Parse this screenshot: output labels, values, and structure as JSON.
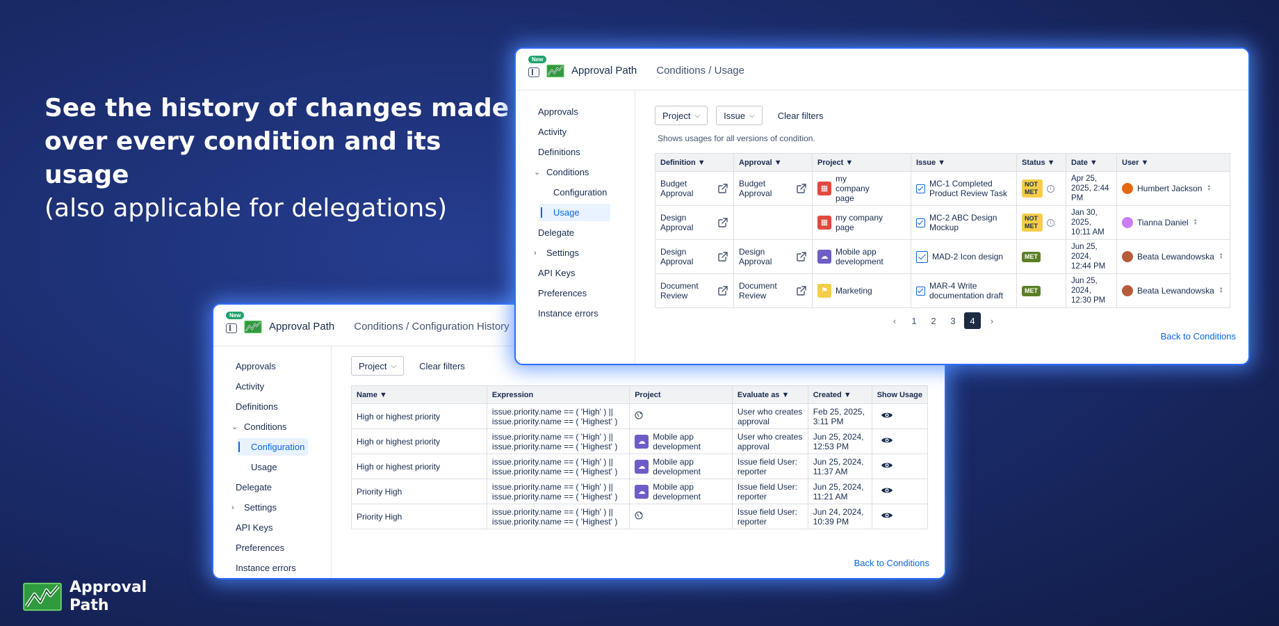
{
  "headline": {
    "bold": "See the history of changes made over every condition and its usage",
    "light": "(also applicable for delegations)"
  },
  "brand": {
    "name_line1": "Approval",
    "name_line2": "Path"
  },
  "colors": {
    "accent": "#0c66e4",
    "glow": "#2d6bff",
    "met": "#5b7f24",
    "not_met": "#f5cd47"
  },
  "usage_window": {
    "badge": "New",
    "app_name": "Approval Path",
    "breadcrumb": "Conditions / Usage",
    "sidebar": [
      "Approvals",
      "Activity",
      "Definitions",
      "Conditions",
      "Configuration",
      "Usage",
      "Delegate",
      "Settings",
      "API Keys",
      "Preferences",
      "Instance errors"
    ],
    "filters": {
      "project": "Project",
      "issue": "Issue",
      "clear": "Clear filters"
    },
    "note": "Shows usages for all versions of condition.",
    "columns": [
      "Definition ▼",
      "Approval ▼",
      "Project ▼",
      "Issue ▼",
      "Status ▼",
      "Date ▼",
      "User ▼"
    ],
    "rows": [
      {
        "definition": "Budget Approval",
        "approval": "Budget Approval",
        "project": "my company page",
        "issue": "MC-1 Completed Product Review Task",
        "status": "NOT MET",
        "date": "Apr 25, 2025, 2:44 PM",
        "user": "Humbert Jackson"
      },
      {
        "definition": "Design Approval",
        "approval": "",
        "project": "my company page",
        "issue": "MC-2 ABC Design Mockup",
        "status": "NOT MET",
        "date": "Jan 30, 2025, 10:11 AM",
        "user": "Tianna Daniel"
      },
      {
        "definition": "Design Approval",
        "approval": "Design Approval",
        "project": "Mobile app development",
        "issue": "MAD-2 Icon design",
        "status": "MET",
        "date": "Jun 25, 2024, 12:44 PM",
        "user": "Beata Lewandowska"
      },
      {
        "definition": "Document Review",
        "approval": "Document Review",
        "project": "Marketing",
        "issue": "MAR-4 Write documentation draft",
        "status": "MET",
        "date": "Jun 25, 2024, 12:30 PM",
        "user": "Beata Lewandowska"
      }
    ],
    "pager": {
      "prev": "‹",
      "pages": [
        "1",
        "2",
        "3",
        "4"
      ],
      "current": "4",
      "next": "›"
    },
    "back": "Back to Conditions"
  },
  "config_window": {
    "badge": "New",
    "app_name": "Approval Path",
    "breadcrumb": "Conditions / Configuration History",
    "sidebar": [
      "Approvals",
      "Activity",
      "Definitions",
      "Conditions",
      "Configuration",
      "Usage",
      "Delegate",
      "Settings",
      "API Keys",
      "Preferences",
      "Instance errors"
    ],
    "filters": {
      "project": "Project",
      "clear": "Clear filters"
    },
    "columns": [
      "Name ▼",
      "Expression",
      "Project",
      "Evaluate as ▼",
      "Created ▼",
      "Show Usage"
    ],
    "rows": [
      {
        "name": "High or highest priority",
        "expr1": "issue.priority.name == ( 'High' ) ||",
        "expr2": "issue.priority.name == ( 'Highest' )",
        "project": "",
        "evaluate": "User who creates approval",
        "created": "Feb 25, 2025, 3:11 PM"
      },
      {
        "name": "High or highest priority",
        "expr1": "issue.priority.name == ( 'High' ) ||",
        "expr2": "issue.priority.name == ( 'Highest' )",
        "project": "Mobile app development",
        "evaluate": "User who creates approval",
        "created": "Jun 25, 2024, 12:53 PM"
      },
      {
        "name": "High or highest priority",
        "expr1": "issue.priority.name == ( 'High' ) ||",
        "expr2": "issue.priority.name == ( 'Highest' )",
        "project": "Mobile app development",
        "evaluate": "Issue field User: reporter",
        "created": "Jun 25, 2024, 11:37 AM"
      },
      {
        "name": "Priority High",
        "expr1": "issue.priority.name == ( 'High' ) ||",
        "expr2": "issue.priority.name == ( 'Highest' )",
        "project": "Mobile app development",
        "evaluate": "Issue field User: reporter",
        "created": "Jun 25, 2024, 11:21 AM"
      },
      {
        "name": "Priority High",
        "expr1": "issue.priority.name == ( 'High' ) ||",
        "expr2": "issue.priority.name == ( 'Highest' )",
        "project": "",
        "evaluate": "Issue field User: reporter",
        "created": "Jun 24, 2024, 10:39 PM"
      }
    ],
    "back": "Back to Conditions"
  }
}
